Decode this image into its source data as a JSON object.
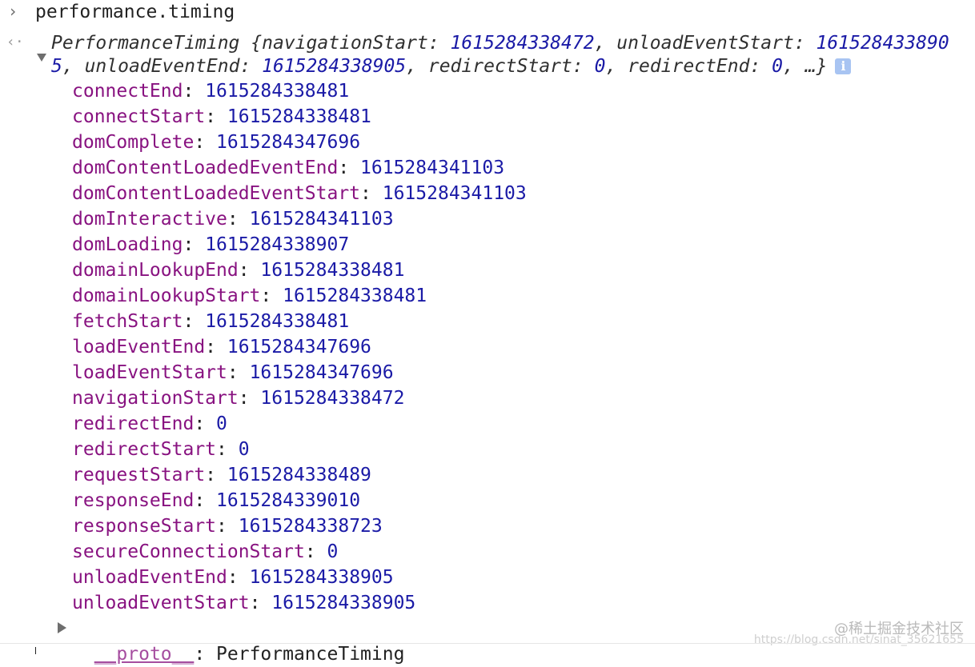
{
  "console": {
    "command": "performance.timing",
    "summary": {
      "class_name": "PerformanceTiming",
      "open_brace": "{",
      "items": [
        {
          "key": "navigationStart",
          "value": "1615284338472"
        },
        {
          "key": "unloadEventStart",
          "value": "1615284338905"
        },
        {
          "key": "unloadEventEnd",
          "value": "1615284338905"
        },
        {
          "key": "redirectStart",
          "value": "0"
        },
        {
          "key": "redirectEnd",
          "value": "0"
        }
      ],
      "ellipsis": "…}",
      "info_icon": "info-icon"
    },
    "properties": [
      {
        "key": "connectEnd",
        "value": "1615284338481"
      },
      {
        "key": "connectStart",
        "value": "1615284338481"
      },
      {
        "key": "domComplete",
        "value": "1615284347696"
      },
      {
        "key": "domContentLoadedEventEnd",
        "value": "1615284341103"
      },
      {
        "key": "domContentLoadedEventStart",
        "value": "1615284341103"
      },
      {
        "key": "domInteractive",
        "value": "1615284341103"
      },
      {
        "key": "domLoading",
        "value": "1615284338907"
      },
      {
        "key": "domainLookupEnd",
        "value": "1615284338481"
      },
      {
        "key": "domainLookupStart",
        "value": "1615284338481"
      },
      {
        "key": "fetchStart",
        "value": "1615284338481"
      },
      {
        "key": "loadEventEnd",
        "value": "1615284347696"
      },
      {
        "key": "loadEventStart",
        "value": "1615284347696"
      },
      {
        "key": "navigationStart",
        "value": "1615284338472"
      },
      {
        "key": "redirectEnd",
        "value": "0"
      },
      {
        "key": "redirectStart",
        "value": "0"
      },
      {
        "key": "requestStart",
        "value": "1615284338489"
      },
      {
        "key": "responseEnd",
        "value": "1615284339010"
      },
      {
        "key": "responseStart",
        "value": "1615284338723"
      },
      {
        "key": "secureConnectionStart",
        "value": "0"
      },
      {
        "key": "unloadEventEnd",
        "value": "1615284338905"
      },
      {
        "key": "unloadEventStart",
        "value": "1615284338905"
      }
    ],
    "proto": {
      "key": "__proto__",
      "value": "PerformanceTiming"
    }
  },
  "watermark": {
    "text": "@稀土掘金技术社区",
    "url": "https://blog.csdn.net/sinat_35621655"
  }
}
